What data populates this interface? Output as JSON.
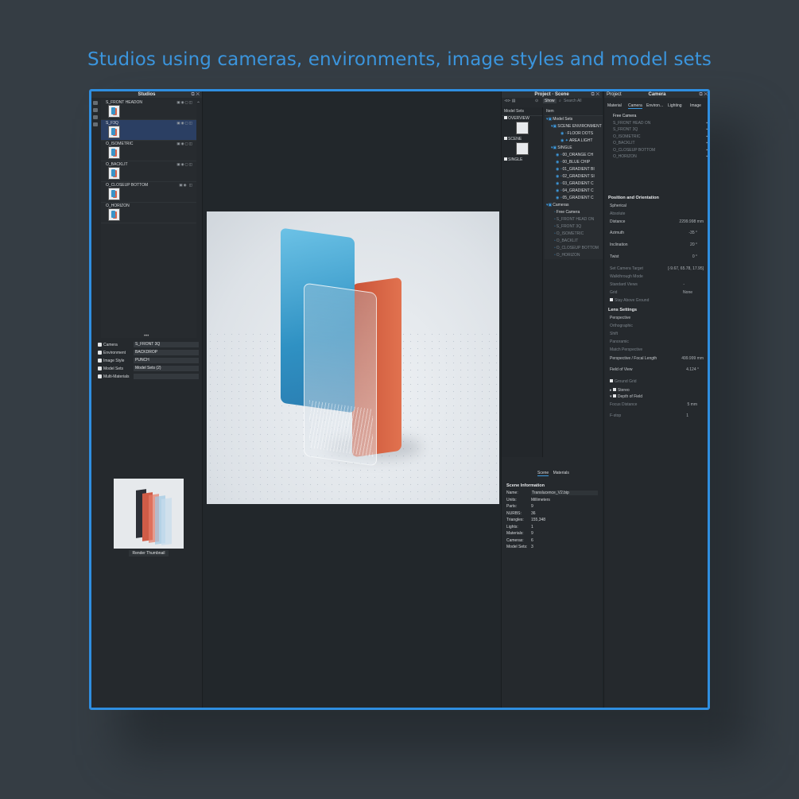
{
  "headline": "Studios using cameras, environments, image styles and model sets",
  "studios_panel": {
    "title": "Studios",
    "studios": [
      {
        "name": "S_FRONT HEADON",
        "selected": false
      },
      {
        "name": "S_F3Q",
        "selected": true
      },
      {
        "name": "O_ISOMETRIC",
        "selected": false
      },
      {
        "name": "O_BACKLIT",
        "selected": false
      },
      {
        "name": "O_CLOSEUP BOTTOM",
        "selected": false
      },
      {
        "name": "O_HORIZON",
        "selected": false
      }
    ],
    "properties": [
      {
        "label": "Camera",
        "value": "S_FRONT 3Q"
      },
      {
        "label": "Environment",
        "value": "BACKDROP"
      },
      {
        "label": "Image Style",
        "value": "PUNCH"
      },
      {
        "label": "Model Sets",
        "value": "Model Sets (2)"
      },
      {
        "label": "Multi-Materials",
        "value": ""
      }
    ],
    "render_button": "Render Thumbnail"
  },
  "scene_panel": {
    "title": "Project · Scene",
    "show_button": "Show",
    "search_placeholder": "Search All",
    "model_sets_header": "Model Sets",
    "model_sets": [
      "OVERVIEW",
      "SCENE",
      "SINGLE"
    ],
    "tree_header": "Item",
    "tree": [
      {
        "label": "Model Sets",
        "dim": false
      },
      {
        "label": "SCENE ENVIRONMENT",
        "dim": false
      },
      {
        "label": "FLOOR DOTS",
        "dim": false
      },
      {
        "label": "AREA LIGHT",
        "dim": false
      },
      {
        "label": "SINGLE",
        "dim": false
      },
      {
        "label": "00_ORANGE CH",
        "dim": false
      },
      {
        "label": "00_BLUE CHIP",
        "dim": false
      },
      {
        "label": "01_GRADIENT BI",
        "dim": false
      },
      {
        "label": "02_GRADIENT SI",
        "dim": false
      },
      {
        "label": "03_GRADIENT C",
        "dim": false
      },
      {
        "label": "04_GRADIENT C",
        "dim": false
      },
      {
        "label": "05_GRADIENT C",
        "dim": false
      },
      {
        "label": "Cameras",
        "dim": false
      },
      {
        "label": "Free Camera",
        "dim": false
      },
      {
        "label": "S_FRONT HEAD ON",
        "dim": true
      },
      {
        "label": "S_FRONT 3Q",
        "dim": true
      },
      {
        "label": "O_ISOMETRIC",
        "dim": true
      },
      {
        "label": "O_BACKLIT",
        "dim": true
      },
      {
        "label": "O_CLOSEUP BOTTOM",
        "dim": true
      },
      {
        "label": "O_HORIZON",
        "dim": true
      }
    ],
    "tabs": [
      "Scene",
      "Materials"
    ],
    "info_title": "Scene Information",
    "info": [
      {
        "k": "Name:",
        "v": "Translucence_V2.bip"
      },
      {
        "k": "Units:",
        "v": "Millimeters"
      },
      {
        "k": "Parts:",
        "v": "9"
      },
      {
        "k": "NURBS:",
        "v": "36"
      },
      {
        "k": "Triangles:",
        "v": "155,348"
      },
      {
        "k": "Lights:",
        "v": "1"
      },
      {
        "k": "Materials:",
        "v": "9"
      },
      {
        "k": "Cameras:",
        "v": "6"
      },
      {
        "k": "Model Sets:",
        "v": "3"
      }
    ]
  },
  "camera_panel": {
    "title_left": "Project",
    "title": "Camera",
    "tabs": [
      "Material",
      "Camera",
      "Environ...",
      "Lighting",
      "Image"
    ],
    "cameras": [
      {
        "label": "Free Camera",
        "dim": false
      },
      {
        "label": "S_FRONT HEAD ON",
        "dim": true
      },
      {
        "label": "S_FRONT 3Q",
        "dim": true
      },
      {
        "label": "O_ISOMETRIC",
        "dim": true
      },
      {
        "label": "O_BACKLIT",
        "dim": true
      },
      {
        "label": "O_CLOSEUP BOTTOM",
        "dim": true
      },
      {
        "label": "O_HORIZON",
        "dim": true
      }
    ],
    "position_section": "Position and Orientation",
    "spherical": "Spherical",
    "absolute": "Absolute",
    "distance_label": "Distance",
    "distance_value": "2299.998 mm",
    "azimuth_label": "Azimuth",
    "azimuth_value": "-35 °",
    "inclination_label": "Inclination",
    "inclination_value": "20 °",
    "twist_label": "Twist",
    "twist_value": "0 °",
    "set_target_label": "Set Camera Target",
    "set_target_value": "[-9.67, 65.78, 17.95]",
    "walkthrough": "Walkthrough Mode",
    "standard_views": "Standard Views",
    "standard_views_value": "-",
    "grid_label": "Grid",
    "grid_value": "None",
    "stay_above": "Stay Above Ground",
    "lens_section": "Lens Settings",
    "lens_options": [
      "Perspective",
      "Orthographic",
      "Shift",
      "Panoramic",
      "Match Perspective"
    ],
    "focal_label": "Perspective / Focal Length",
    "focal_value": "499.999 mm",
    "fov_label": "Field of View",
    "fov_value": "4.124 °",
    "ground_grid": "Ground Grid",
    "stereo": "Stereo",
    "dof": "Depth of Field",
    "focus_label": "Focus Distance",
    "focus_value": "5 mm",
    "fstop_label": "F-stop",
    "fstop_value": "1"
  }
}
